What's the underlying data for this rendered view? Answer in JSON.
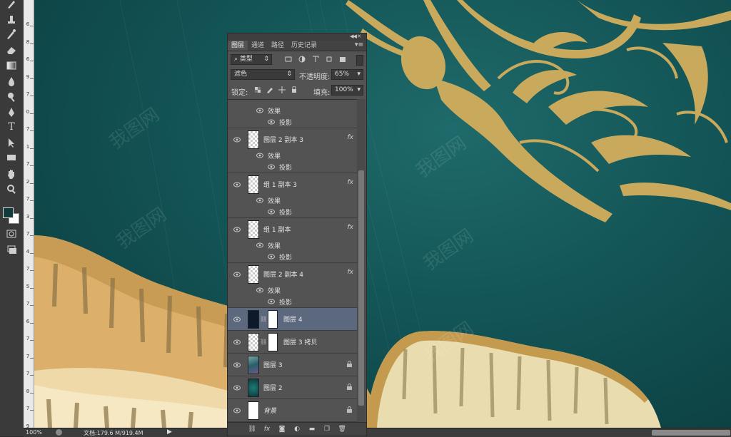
{
  "panel": {
    "tabs": [
      "图层",
      "通道",
      "路径",
      "历史记录"
    ],
    "filter_kind": "类型",
    "blend_mode": "滤色",
    "opacity_label": "不透明度:",
    "opacity_value": "65%",
    "lock_label": "锁定:",
    "fill_label": "填充:",
    "fill_value": "100%",
    "partial_row": {
      "effects": "效果",
      "effect": "投影"
    },
    "layers": [
      {
        "name": "图层 2 副本 3",
        "has_fx": true,
        "effects": "效果",
        "effect": "投影"
      },
      {
        "name": "组 1 副本 3",
        "has_fx": true,
        "effects": "效果",
        "effect": "投影"
      },
      {
        "name": "组 1 副本",
        "has_fx": true,
        "effects": "效果",
        "effect": "投影"
      },
      {
        "name": "图层 2 副本 4",
        "has_fx": true,
        "effects": "效果",
        "effect": "投影"
      },
      {
        "name": "图层 4",
        "selected": true,
        "has_mask": true
      },
      {
        "name": "图层 3 拷贝",
        "has_mask": true
      },
      {
        "name": "图层 3",
        "locked": true
      },
      {
        "name": "图层 2",
        "locked": true
      },
      {
        "name": "背景",
        "locked": true
      }
    ]
  },
  "ruler": {
    "labels": [
      "6",
      "8",
      "6",
      "9",
      "7",
      "0",
      "7",
      "1",
      "7",
      "2",
      "7",
      "3",
      "7",
      "4",
      "7",
      "5",
      "7",
      "6",
      "7",
      "7",
      "7",
      "8",
      "7",
      "9"
    ]
  },
  "status": {
    "zoom": "100%",
    "doc_info": "文档:179.6 M/919.4M"
  },
  "colors": {
    "foreground": "#113a3b",
    "background": "#ffffff",
    "selected_layer": "#5b687d"
  },
  "watermark": "我图网"
}
